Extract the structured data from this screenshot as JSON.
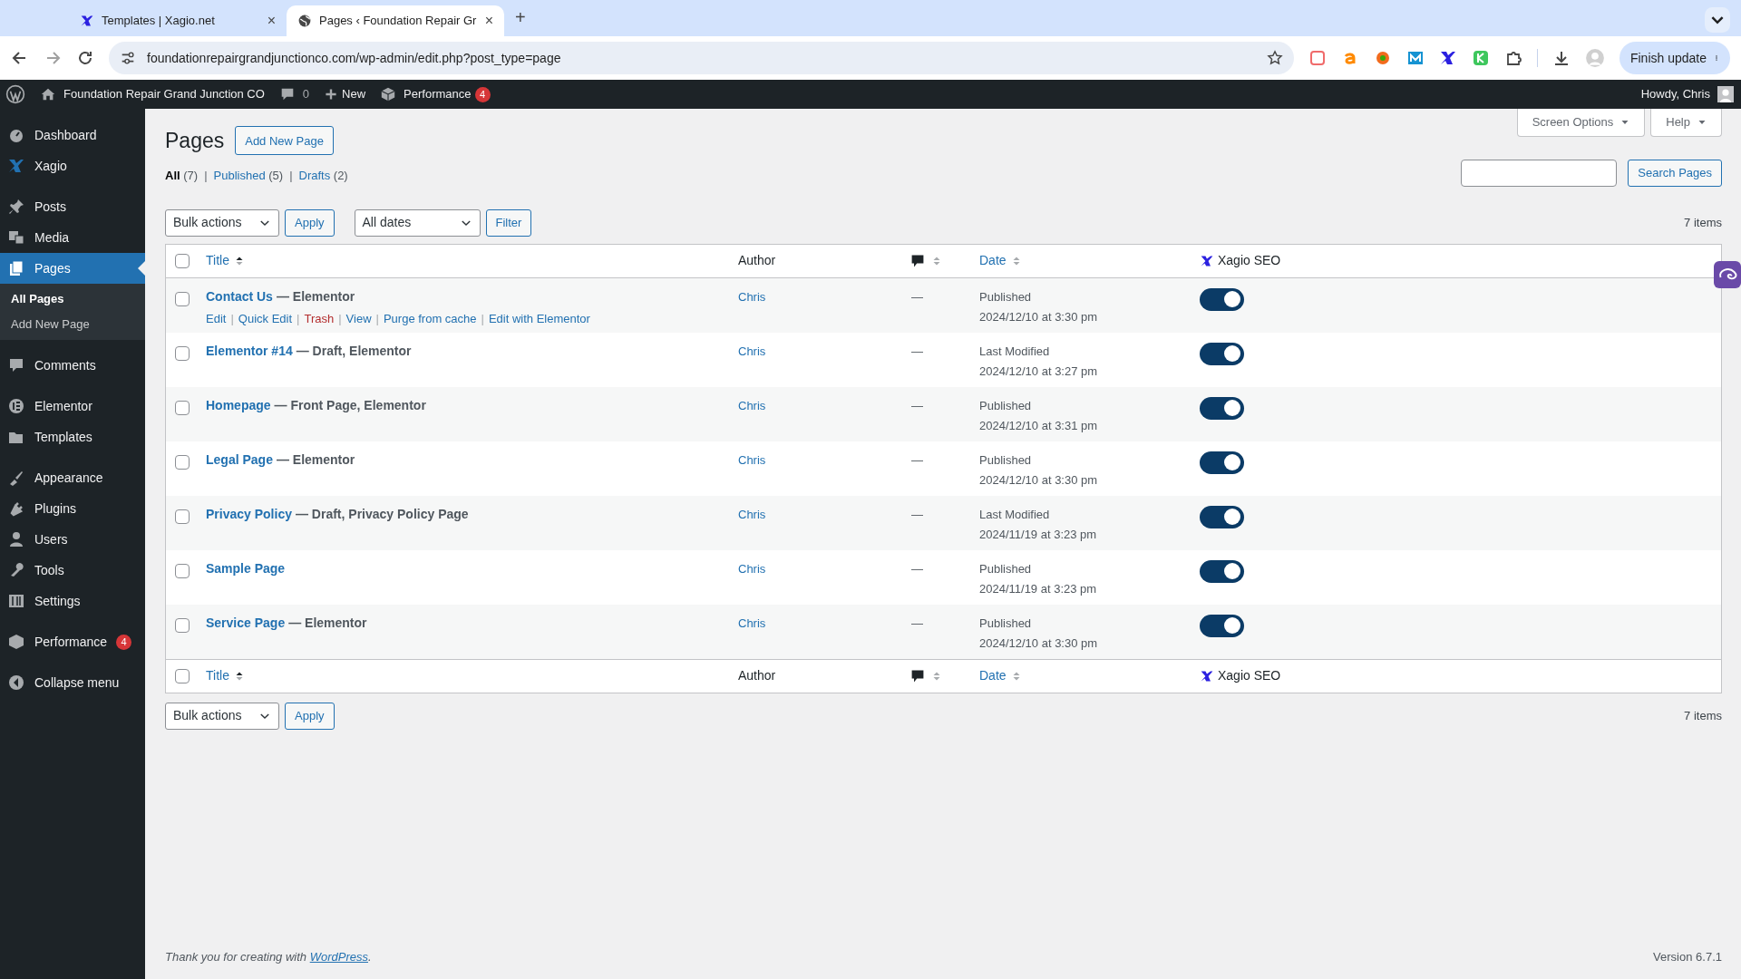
{
  "browser": {
    "tabs": [
      {
        "title": "Templates | Xagio.net",
        "selected": false,
        "close": "×"
      },
      {
        "title": "Pages ‹ Foundation Repair Gr",
        "selected": true,
        "close": "×"
      }
    ],
    "new_tab": "+",
    "url": "foundationrepairgrandjunctionco.com/wp-admin/edit.php?post_type=page",
    "update_button": "Finish update"
  },
  "admin_bar": {
    "site_name": "Foundation Repair Grand Junction CO",
    "comments": "0",
    "new": "New",
    "performance": "Performance",
    "performance_badge": "4",
    "howdy": "Howdy, Chris"
  },
  "sidebar": {
    "groups": [
      [
        {
          "label": "Dashboard",
          "selected": false
        },
        {
          "label": "Xagio",
          "selected": false
        }
      ],
      [
        {
          "label": "Posts",
          "selected": false
        },
        {
          "label": "Media",
          "selected": false
        },
        {
          "label": "Pages",
          "selected": true,
          "children": [
            {
              "label": "All Pages",
              "selected": true
            },
            {
              "label": "Add New Page",
              "selected": false
            }
          ]
        }
      ],
      [
        {
          "label": "Comments",
          "selected": false
        }
      ],
      [
        {
          "label": "Elementor",
          "selected": false
        },
        {
          "label": "Templates",
          "selected": false
        }
      ],
      [
        {
          "label": "Appearance",
          "selected": false
        },
        {
          "label": "Plugins",
          "selected": false
        },
        {
          "label": "Users",
          "selected": false
        },
        {
          "label": "Tools",
          "selected": false
        },
        {
          "label": "Settings",
          "selected": false
        }
      ],
      [
        {
          "label": "Performance",
          "selected": false,
          "badge": "4"
        }
      ],
      [
        {
          "label": "Collapse menu",
          "selected": false
        }
      ]
    ]
  },
  "screen_tabs": [
    "Screen Options",
    "Help"
  ],
  "page_title": "Pages",
  "add_new": "Add New Page",
  "views": {
    "separator": "|",
    "items": [
      {
        "label": "All",
        "count": "(7)",
        "selected": true
      },
      {
        "label": "Published",
        "count": "(5)",
        "selected": false
      },
      {
        "label": "Drafts",
        "count": "(2)",
        "selected": false
      }
    ]
  },
  "search_button": "Search Pages",
  "top_toolbar": {
    "bulk_actions": "Bulk actions",
    "apply": "Apply",
    "dates": "All dates",
    "filter": "Filter",
    "count": "7 items"
  },
  "table": {
    "header": {
      "title": "Title",
      "author": "Author",
      "date": "Date",
      "seo": "Xagio SEO",
      "checked": false
    },
    "footer_header": {
      "title": "Title",
      "author": "Author",
      "date": "Date",
      "seo": "Xagio SEO",
      "checked": false
    },
    "rows": [
      {
        "title": "Contact Us",
        "states": "— Elementor",
        "author": "Chris",
        "comments": "—",
        "status": "Published",
        "date": "2024/12/10 at 3:30 pm",
        "seo_on": true,
        "checked": false,
        "actions_separator": "|",
        "actions": [
          {
            "label": "Edit",
            "kind": "link"
          },
          {
            "label": "Quick Edit",
            "kind": "link"
          },
          {
            "label": "Trash",
            "kind": "delete"
          },
          {
            "label": "View",
            "kind": "link"
          },
          {
            "label": "Purge from cache",
            "kind": "link"
          },
          {
            "label": "Edit with Elementor",
            "kind": "link"
          }
        ]
      },
      {
        "title": "Elementor #14",
        "states": "— Draft, Elementor",
        "author": "Chris",
        "comments": "—",
        "status": "Last Modified",
        "date": "2024/12/10 at 3:27 pm",
        "seo_on": true,
        "checked": false
      },
      {
        "title": "Homepage",
        "states": "— Front Page, Elementor",
        "author": "Chris",
        "comments": "—",
        "status": "Published",
        "date": "2024/12/10 at 3:31 pm",
        "seo_on": true,
        "checked": false
      },
      {
        "title": "Legal Page",
        "states": "— Elementor",
        "author": "Chris",
        "comments": "—",
        "status": "Published",
        "date": "2024/12/10 at 3:30 pm",
        "seo_on": true,
        "checked": false
      },
      {
        "title": "Privacy Policy",
        "states": "— Draft, Privacy Policy Page",
        "author": "Chris",
        "comments": "—",
        "status": "Last Modified",
        "date": "2024/11/19 at 3:23 pm",
        "seo_on": true,
        "checked": false
      },
      {
        "title": "Sample Page",
        "author": "Chris",
        "comments": "—",
        "status": "Published",
        "date": "2024/11/19 at 3:23 pm",
        "seo_on": true,
        "checked": false
      },
      {
        "title": "Service Page",
        "states": "— Elementor",
        "author": "Chris",
        "comments": "—",
        "status": "Published",
        "date": "2024/12/10 at 3:30 pm",
        "seo_on": true,
        "checked": false
      }
    ]
  },
  "bottom_toolbar": {
    "bulk_actions": "Bulk actions",
    "apply": "Apply",
    "count": "7 items"
  },
  "footer": {
    "text": "Thank you for creating with",
    "link": "WordPress",
    "end": ".",
    "version": "Version 6.7.1"
  }
}
